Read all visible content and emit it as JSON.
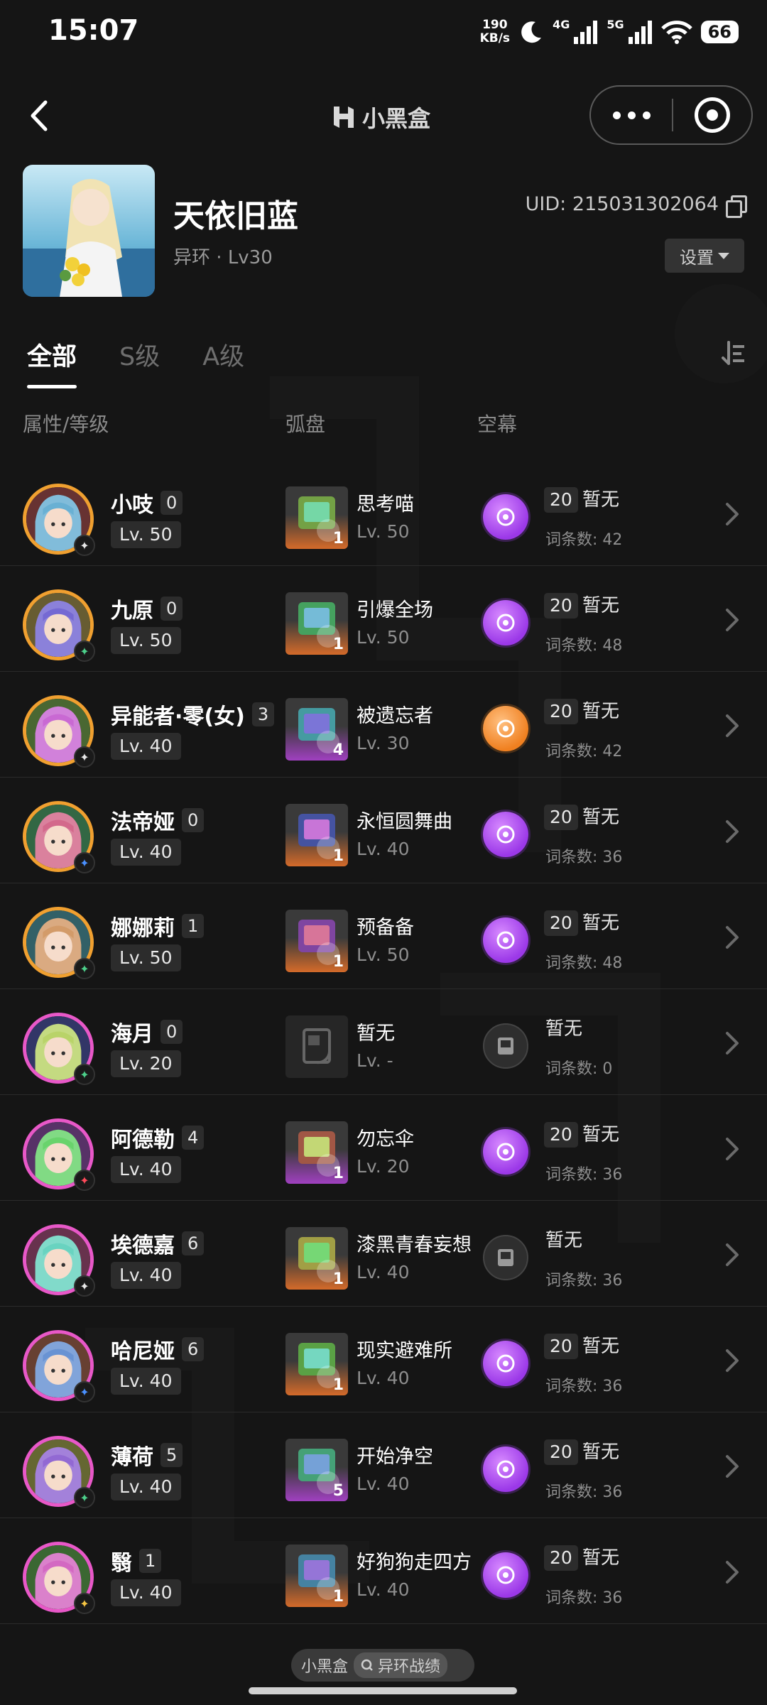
{
  "status_bar": {
    "time": "15:07",
    "net_speed_value": "190",
    "net_speed_unit": "KB/s",
    "sig1": "4G",
    "sig2": "5G",
    "battery": "66"
  },
  "header": {
    "brand": "小黑盒"
  },
  "profile": {
    "name": "天依旧蓝",
    "game": "异环",
    "dot": "·",
    "level": "Lv30",
    "uid": "UID: 215031302064",
    "settings": "设置"
  },
  "tabs": [
    "全部",
    "S级",
    "A级"
  ],
  "columns": {
    "attr": "属性/等级",
    "disk": "弧盘",
    "curtain": "空幕"
  },
  "rows": [
    {
      "name": "小吱",
      "rank": "0",
      "lv": "Lv. 50",
      "disk_name": "思考喵",
      "disk_lv": "Lv. 50",
      "disk_num": "1",
      "cur_lv": "20",
      "cur_state": "暂无",
      "cur_count": "词条数: 42"
    },
    {
      "name": "九原",
      "rank": "0",
      "lv": "Lv. 50",
      "disk_name": "引爆全场",
      "disk_lv": "Lv. 50",
      "disk_num": "1",
      "cur_lv": "20",
      "cur_state": "暂无",
      "cur_count": "词条数: 48"
    },
    {
      "name": "异能者·零(女)",
      "rank": "3",
      "lv": "Lv. 40",
      "disk_name": "被遗忘者",
      "disk_lv": "Lv. 30",
      "disk_num": "4",
      "cur_lv": "20",
      "cur_state": "暂无",
      "cur_count": "词条数: 42"
    },
    {
      "name": "法帝娅",
      "rank": "0",
      "lv": "Lv. 40",
      "disk_name": "永恒圆舞曲",
      "disk_lv": "Lv. 40",
      "disk_num": "1",
      "cur_lv": "20",
      "cur_state": "暂无",
      "cur_count": "词条数: 36"
    },
    {
      "name": "娜娜莉",
      "rank": "1",
      "lv": "Lv. 50",
      "disk_name": "预备备",
      "disk_lv": "Lv. 50",
      "disk_num": "1",
      "cur_lv": "20",
      "cur_state": "暂无",
      "cur_count": "词条数: 48"
    },
    {
      "name": "海月",
      "rank": "0",
      "lv": "Lv. 20",
      "disk_name": "暂无",
      "disk_lv": "Lv. -",
      "disk_num": "",
      "cur_lv": "",
      "cur_state": "暂无",
      "cur_count": "词条数: 0"
    },
    {
      "name": "阿德勒",
      "rank": "4",
      "lv": "Lv. 40",
      "disk_name": "勿忘伞",
      "disk_lv": "Lv. 20",
      "disk_num": "1",
      "cur_lv": "20",
      "cur_state": "暂无",
      "cur_count": "词条数: 36"
    },
    {
      "name": "埃德嘉",
      "rank": "6",
      "lv": "Lv. 40",
      "disk_name": "漆黑青春妄想",
      "disk_lv": "Lv. 40",
      "disk_num": "1",
      "cur_lv": "",
      "cur_state": "暂无",
      "cur_count": "词条数: 36"
    },
    {
      "name": "哈尼娅",
      "rank": "6",
      "lv": "Lv. 40",
      "disk_name": "现实避难所",
      "disk_lv": "Lv. 40",
      "disk_num": "1",
      "cur_lv": "20",
      "cur_state": "暂无",
      "cur_count": "词条数: 36"
    },
    {
      "name": "薄荷",
      "rank": "5",
      "lv": "Lv. 40",
      "disk_name": "开始净空",
      "disk_lv": "Lv. 40",
      "disk_num": "5",
      "cur_lv": "20",
      "cur_state": "暂无",
      "cur_count": "词条数: 36"
    },
    {
      "name": "翳",
      "rank": "1",
      "lv": "Lv. 40",
      "disk_name": "好狗狗走四方",
      "disk_lv": "Lv. 40",
      "disk_num": "1",
      "cur_lv": "20",
      "cur_state": "暂无",
      "cur_count": "词条数: 36"
    }
  ],
  "row_visuals": [
    {
      "frame": "orange",
      "attr": "light",
      "disk_color": "orange",
      "cur": "purple"
    },
    {
      "frame": "orange",
      "attr": "green",
      "disk_color": "orange",
      "cur": "purple"
    },
    {
      "frame": "orange",
      "attr": "light",
      "disk_color": "purple",
      "cur": "orange"
    },
    {
      "frame": "orange",
      "attr": "blue",
      "disk_color": "orange",
      "cur": "purple"
    },
    {
      "frame": "orange",
      "attr": "green",
      "disk_color": "orange",
      "cur": "purple"
    },
    {
      "frame": "pink",
      "attr": "green",
      "disk_color": "empty",
      "cur": "empty"
    },
    {
      "frame": "pink",
      "attr": "red",
      "disk_color": "purple",
      "cur": "purple"
    },
    {
      "frame": "pink",
      "attr": "light",
      "disk_color": "orange",
      "cur": "empty"
    },
    {
      "frame": "pink",
      "attr": "blue",
      "disk_color": "orange",
      "cur": "purple"
    },
    {
      "frame": "pink",
      "attr": "green",
      "disk_color": "purple",
      "cur": "purple"
    },
    {
      "frame": "pink",
      "attr": "gold",
      "disk_color": "orange",
      "cur": "purple"
    }
  ],
  "bottom": {
    "brand": "小黑盒",
    "link": "异环战绩"
  }
}
